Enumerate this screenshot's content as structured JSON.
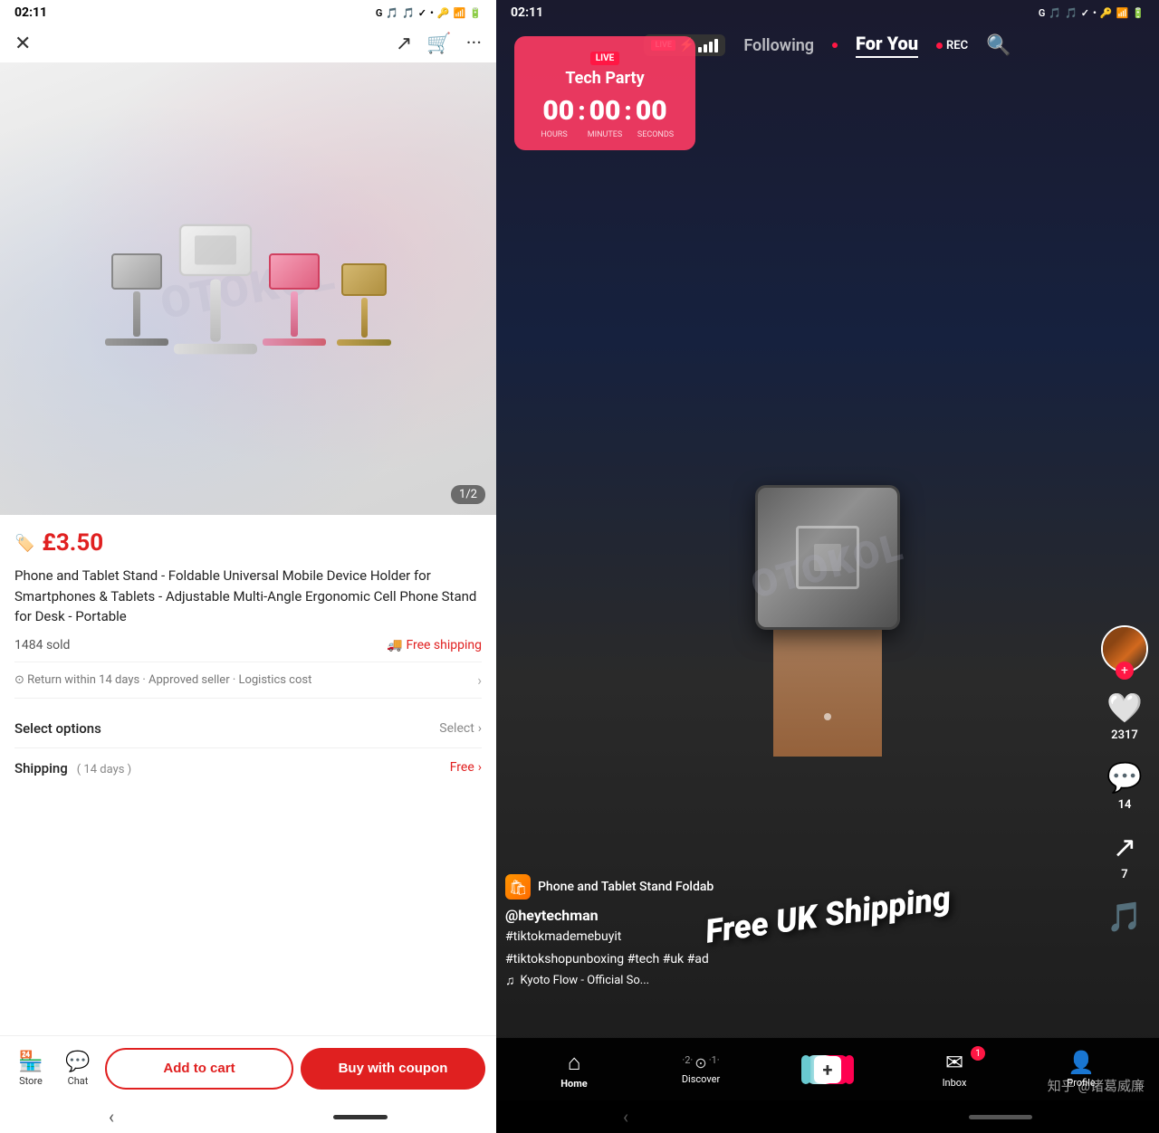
{
  "left": {
    "status": {
      "time": "02:11",
      "icons": "G 🎵 🎵 ✓ •"
    },
    "nav": {
      "close_icon": "✕",
      "share_icon": "↗",
      "cart_icon": "🛒",
      "more_icon": "···"
    },
    "product": {
      "price_icon": "🏷️",
      "price": "£3.50",
      "title": "Phone and Tablet Stand - Foldable Universal Mobile Device Holder for Smartphones & Tablets - Adjustable Multi-Angle Ergonomic Cell Phone Stand for Desk - Portable",
      "sold": "1484 sold",
      "free_shipping": "Free shipping",
      "return_text": "Return within 14 days · Approved seller · Logistics cost",
      "image_counter": "1/2"
    },
    "options": {
      "label": "Select options",
      "select_label": "Select"
    },
    "shipping": {
      "label": "Shipping",
      "days": "( 14 days )",
      "cost": "Free"
    },
    "bottom_nav": {
      "store_label": "Store",
      "chat_label": "Chat",
      "add_cart_label": "Add to cart",
      "buy_coupon_label": "Buy with coupon"
    }
  },
  "right": {
    "status": {
      "time": "02:11",
      "icons": "G 🎵 🎵 ✓ •"
    },
    "top_nav": {
      "live_label": "LIVE",
      "following_label": "Following",
      "for_you_label": "For You",
      "rec_label": "REC"
    },
    "live_event": {
      "badge": "LIVE",
      "title": "Tech Party",
      "hours": "00",
      "minutes": "00",
      "seconds": "00",
      "hours_label": "HOURS",
      "minutes_label": "MINUTES",
      "seconds_label": "SECONDS"
    },
    "video": {
      "watermark": "OTOKOL",
      "shipping_text": "Free UK Shipping"
    },
    "product_overlay": {
      "product_name": "Phone and Tablet Stand  Foldab"
    },
    "creator": {
      "handle": "@heytechman",
      "hashtags": "#tiktokmademebuyit",
      "hashtags2": "#tiktokshopunboxing #tech #uk #ad",
      "music": "Kyoto Flow - Official So..."
    },
    "actions": {
      "likes": "2317",
      "comments": "14",
      "shares": "7"
    },
    "bottom_nav": {
      "home_label": "Home",
      "discover_label": "Discover",
      "inbox_label": "Inbox",
      "inbox_badge": "1",
      "profile_label": "Profile"
    },
    "zhihu": "知乎 @诸葛威廉"
  }
}
